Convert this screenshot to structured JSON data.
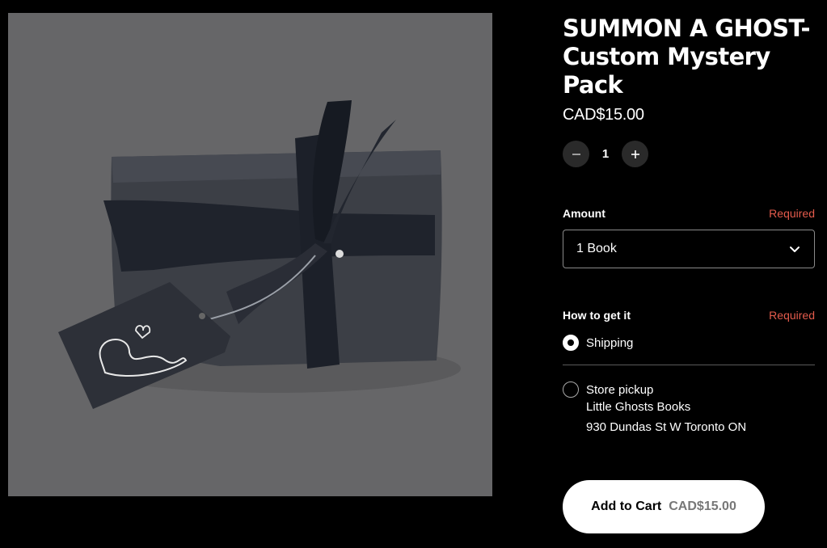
{
  "product": {
    "title": "SUMMON A GHOST- Custom Mystery Pack",
    "price": "CAD$15.00"
  },
  "quantity": {
    "value": "1",
    "decrement_icon": "minus-icon",
    "increment_icon": "plus-icon"
  },
  "amount": {
    "label": "Amount",
    "required": "Required",
    "selected": "1 Book"
  },
  "fulfillment": {
    "label": "How to get it",
    "required": "Required",
    "options": [
      {
        "label": "Shipping",
        "selected": true
      },
      {
        "label": "Store pickup",
        "selected": false
      }
    ],
    "store_name": "Little Ghosts Books",
    "store_address": "930 Dundas St W Toronto ON"
  },
  "cart": {
    "label": "Add to Cart",
    "price": "CAD$15.00"
  },
  "colors": {
    "background": "#000000",
    "required": "#e45b4c",
    "image_bg": "#666668"
  }
}
